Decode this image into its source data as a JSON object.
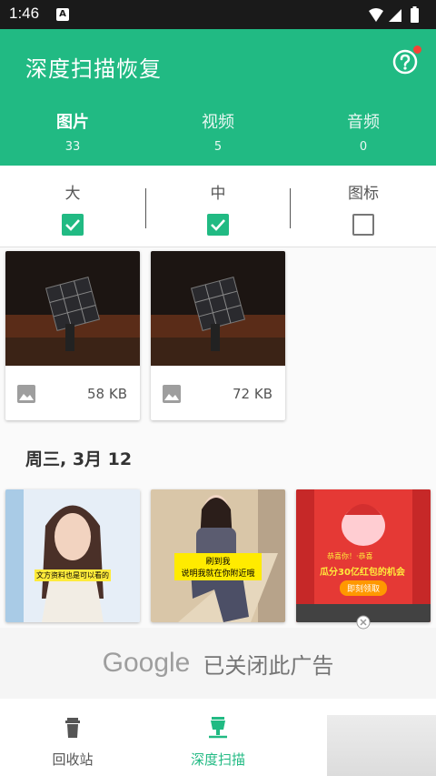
{
  "status_bar": {
    "time": "1:46"
  },
  "app_bar": {
    "title": "深度扫描恢复"
  },
  "tabs": [
    {
      "label": "图片",
      "count": "33"
    },
    {
      "label": "视频",
      "count": "5"
    },
    {
      "label": "音频",
      "count": "0"
    }
  ],
  "filters": [
    {
      "label": "大",
      "checked": true
    },
    {
      "label": "中",
      "checked": true
    },
    {
      "label": "图标",
      "checked": false
    }
  ],
  "cards_top": [
    {
      "size": "58 KB"
    },
    {
      "size": "72 KB"
    }
  ],
  "date_header": "周三, 3月 12",
  "cards_bottom": [
    {
      "caption": "文方资料也是可以看的"
    },
    {
      "caption_line1": "刷到我",
      "caption_line2": "说明我就在你附近哦"
    },
    {
      "ad_top": "恭喜你！·恭喜",
      "ad_main": "瓜分30亿红包的机会",
      "ad_button": "即刻领取"
    }
  ],
  "ad": {
    "brand": "Google",
    "text": "已关闭此广告"
  },
  "bottom_nav": [
    {
      "label": "回收站"
    },
    {
      "label": "深度扫描"
    }
  ],
  "colors": {
    "primary": "#21ba83",
    "status_bar": "#1a1a1a"
  }
}
